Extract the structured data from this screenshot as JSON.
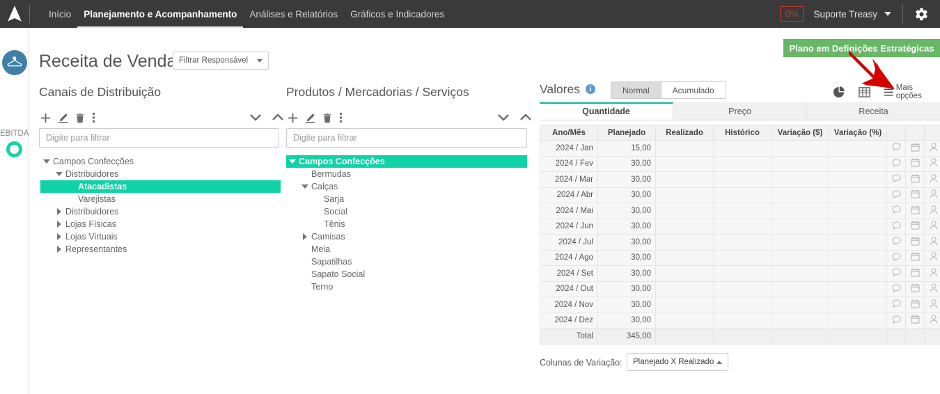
{
  "topbar": {
    "logo_icon": "arrow-logo-icon",
    "nav": [
      {
        "label": "Início",
        "active": false
      },
      {
        "label": "Planejamento e Acompanhamento",
        "active": true
      },
      {
        "label": "Análises e Relatórios",
        "active": false
      },
      {
        "label": "Gráficos e Indicadores",
        "active": false
      }
    ],
    "progress_badge": "0%",
    "user_name": "Suporte Treasy",
    "user_caret_icon": "chevron-down-icon",
    "settings_icon": "gear-icon",
    "bg_color": "#3a3a3a",
    "badge_color": "#c0392b"
  },
  "rail": {
    "avatar_icon": "clothes-hanger-icon",
    "avatar_color": "#3f7fa8",
    "metric_label": "EBITDA",
    "ring_color": "#16d3a5"
  },
  "header": {
    "title": "Receita de Vendas",
    "responsible_filter": {
      "label": "Filtrar Responsável",
      "caret_icon": "chevron-down-icon"
    },
    "banner": {
      "text": "Plano em Definições Estratégicas",
      "color": "#68b767"
    },
    "annotation_arrow_color": "#d40000"
  },
  "channels_panel": {
    "heading": "Canais de Distribuição",
    "toolbar": [
      {
        "icon": "plus-icon",
        "name": "add-channel-button"
      },
      {
        "icon": "pencil-icon",
        "name": "edit-channel-button"
      },
      {
        "icon": "trash-icon",
        "name": "delete-channel-button"
      },
      {
        "icon": "vertical-dots-icon",
        "name": "channel-more-button"
      }
    ],
    "collapse_icons": [
      {
        "icon": "chevron-down-icon",
        "name": "expand-all-channels-button"
      },
      {
        "icon": "chevron-up-icon",
        "name": "collapse-all-channels-button"
      }
    ],
    "filter_placeholder": "Digite para filtrar",
    "filter_value": "",
    "tree": [
      {
        "label": "Campos Confecções",
        "depth": 0,
        "arrow": "down",
        "selected": false
      },
      {
        "label": "Distribuidores",
        "depth": 1,
        "arrow": "down",
        "selected": false
      },
      {
        "label": "Atacadistas",
        "depth": 2,
        "arrow": "none",
        "selected": true
      },
      {
        "label": "Varejistas",
        "depth": 2,
        "arrow": "none",
        "selected": false
      },
      {
        "label": "Distribuidores",
        "depth": 1,
        "arrow": "right",
        "selected": false
      },
      {
        "label": "Lojas Físicas",
        "depth": 1,
        "arrow": "right",
        "selected": false
      },
      {
        "label": "Lojas Virtuais",
        "depth": 1,
        "arrow": "right",
        "selected": false
      },
      {
        "label": "Representantes",
        "depth": 1,
        "arrow": "right",
        "selected": false
      }
    ]
  },
  "products_panel": {
    "heading": "Produtos / Mercadorias / Serviços",
    "toolbar": [
      {
        "icon": "plus-icon",
        "name": "add-product-button"
      },
      {
        "icon": "pencil-icon",
        "name": "edit-product-button"
      },
      {
        "icon": "trash-icon",
        "name": "delete-product-button"
      },
      {
        "icon": "vertical-dots-icon",
        "name": "product-more-button"
      }
    ],
    "collapse_icons": [
      {
        "icon": "chevron-down-icon",
        "name": "expand-all-products-button"
      },
      {
        "icon": "chevron-up-icon",
        "name": "collapse-all-products-button"
      }
    ],
    "filter_placeholder": "Digite para filtrar",
    "filter_value": "",
    "tree": [
      {
        "label": "Campos Confecções",
        "depth": 0,
        "arrow": "down",
        "selected": true
      },
      {
        "label": "Bermudas",
        "depth": 1,
        "arrow": "none",
        "selected": false
      },
      {
        "label": "Calças",
        "depth": 1,
        "arrow": "down",
        "selected": false
      },
      {
        "label": "Sarja",
        "depth": 2,
        "arrow": "none",
        "selected": false
      },
      {
        "label": "Social",
        "depth": 2,
        "arrow": "none",
        "selected": false
      },
      {
        "label": "Tênis",
        "depth": 2,
        "arrow": "none",
        "selected": false
      },
      {
        "label": "Camisas",
        "depth": 1,
        "arrow": "right",
        "selected": false
      },
      {
        "label": "Meia",
        "depth": 1,
        "arrow": "none",
        "selected": false
      },
      {
        "label": "Sapatilhas",
        "depth": 1,
        "arrow": "none",
        "selected": false
      },
      {
        "label": "Sapato Social",
        "depth": 1,
        "arrow": "none",
        "selected": false
      },
      {
        "label": "Terno",
        "depth": 1,
        "arrow": "none",
        "selected": false
      }
    ]
  },
  "values_panel": {
    "heading": "Valores",
    "info_icon": "info-icon",
    "mode_toggle": [
      {
        "label": "Normal",
        "active": true
      },
      {
        "label": "Acumulado",
        "active": false
      }
    ],
    "right_icons": [
      {
        "icon": "pie-chart-icon",
        "name": "chart-view-button"
      },
      {
        "icon": "table-icon",
        "name": "table-view-button"
      }
    ],
    "more_options": {
      "label": "Mais opções",
      "icon": "hamburger-icon"
    },
    "tabs": [
      {
        "label": "Quantidade",
        "active": true
      },
      {
        "label": "Preço",
        "active": false
      },
      {
        "label": "Receita",
        "active": false
      }
    ],
    "accent_color": "#0fb894"
  },
  "table": {
    "columns": [
      "Ano/Mês",
      "Planejado",
      "Realizado",
      "Histórico",
      "Variação ($)",
      "Variação (%)"
    ],
    "row_icons": [
      {
        "icon": "comment-icon",
        "name": "row-comment-button"
      },
      {
        "icon": "calendar-icon",
        "name": "row-schedule-button"
      },
      {
        "icon": "user-icon",
        "name": "row-responsible-button"
      }
    ],
    "rows": [
      {
        "period": "2024 / Jan",
        "planejado": "15,00",
        "realizado": "",
        "historico": "",
        "variacao_valor": "",
        "variacao_pct": ""
      },
      {
        "period": "2024 / Fev",
        "planejado": "30,00",
        "realizado": "",
        "historico": "",
        "variacao_valor": "",
        "variacao_pct": ""
      },
      {
        "period": "2024 / Mar",
        "planejado": "30,00",
        "realizado": "",
        "historico": "",
        "variacao_valor": "",
        "variacao_pct": ""
      },
      {
        "period": "2024 / Abr",
        "planejado": "30,00",
        "realizado": "",
        "historico": "",
        "variacao_valor": "",
        "variacao_pct": ""
      },
      {
        "period": "2024 / Mai",
        "planejado": "30,00",
        "realizado": "",
        "historico": "",
        "variacao_valor": "",
        "variacao_pct": ""
      },
      {
        "period": "2024 / Jun",
        "planejado": "30,00",
        "realizado": "",
        "historico": "",
        "variacao_valor": "",
        "variacao_pct": ""
      },
      {
        "period": "2024 / Jul",
        "planejado": "30,00",
        "realizado": "",
        "historico": "",
        "variacao_valor": "",
        "variacao_pct": ""
      },
      {
        "period": "2024 / Ago",
        "planejado": "30,00",
        "realizado": "",
        "historico": "",
        "variacao_valor": "",
        "variacao_pct": ""
      },
      {
        "period": "2024 / Set",
        "planejado": "30,00",
        "realizado": "",
        "historico": "",
        "variacao_valor": "",
        "variacao_pct": ""
      },
      {
        "period": "2024 / Out",
        "planejado": "30,00",
        "realizado": "",
        "historico": "",
        "variacao_valor": "",
        "variacao_pct": ""
      },
      {
        "period": "2024 / Nov",
        "planejado": "30,00",
        "realizado": "",
        "historico": "",
        "variacao_valor": "",
        "variacao_pct": ""
      },
      {
        "period": "2024 / Dez",
        "planejado": "30,00",
        "realizado": "",
        "historico": "",
        "variacao_valor": "",
        "variacao_pct": ""
      }
    ],
    "total_row": {
      "period": "Total",
      "planejado": "345,00",
      "realizado": "",
      "historico": "",
      "variacao_valor": "",
      "variacao_pct": ""
    }
  },
  "footer": {
    "variation_label": "Colunas de Variação:",
    "variation_value": "Planejado X Realizado",
    "variation_caret_icon": "chevron-up-icon"
  }
}
